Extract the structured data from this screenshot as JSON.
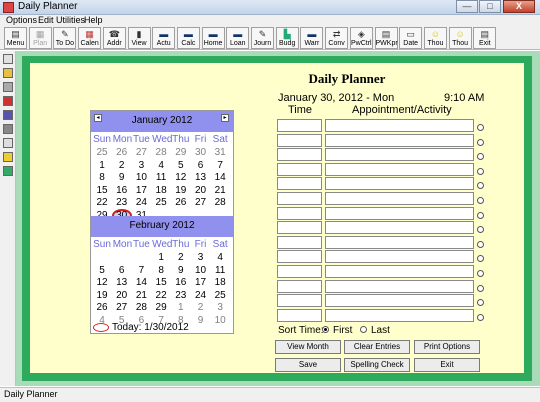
{
  "window": {
    "title": "Daily Planner",
    "min": "—",
    "max": "□",
    "close": "X"
  },
  "menu": [
    "Options",
    "Edit",
    "Utilities",
    "Help"
  ],
  "toolbar": [
    {
      "label": "Menu",
      "icon": "menu-icon",
      "glyph": "▤",
      "color": "#333"
    },
    {
      "label": "Plan",
      "icon": "plan-icon",
      "glyph": "▦",
      "color": "#a0a0a0",
      "disabled": true
    },
    {
      "label": "To Do",
      "icon": "todo-icon",
      "glyph": "✎",
      "color": "#333"
    },
    {
      "label": "Calen",
      "icon": "calendar-icon",
      "glyph": "▦",
      "color": "#b33"
    },
    {
      "label": "Addr",
      "icon": "address-icon",
      "glyph": "☎",
      "color": "#333"
    },
    {
      "label": "View",
      "icon": "view-icon",
      "glyph": "▮",
      "color": "#333"
    },
    {
      "label": "Actu",
      "icon": "actual-icon",
      "glyph": "▬",
      "color": "#136"
    },
    {
      "label": "Calc",
      "icon": "calculator-icon",
      "glyph": "▬",
      "color": "#136"
    },
    {
      "label": "Home",
      "icon": "home-icon",
      "glyph": "▬",
      "color": "#136"
    },
    {
      "label": "Loan",
      "icon": "loan-icon",
      "glyph": "▬",
      "color": "#136"
    },
    {
      "label": "Journ",
      "icon": "journal-icon",
      "glyph": "✎",
      "color": "#333"
    },
    {
      "label": "Budg",
      "icon": "budget-icon",
      "glyph": "▙",
      "color": "#2a7"
    },
    {
      "label": "Warr",
      "icon": "warranty-icon",
      "glyph": "▬",
      "color": "#136"
    },
    {
      "label": "Conv",
      "icon": "convert-icon",
      "glyph": "⇄",
      "color": "#333"
    },
    {
      "label": "PwCtrl",
      "icon": "password-icon",
      "glyph": "◈",
      "color": "#333"
    },
    {
      "label": "PWKpr",
      "icon": "password-keeper-icon",
      "glyph": "▤",
      "color": "#333"
    },
    {
      "label": "Date",
      "icon": "date-icon",
      "glyph": "▭",
      "color": "#333"
    },
    {
      "label": "Thou",
      "icon": "thought-icon",
      "glyph": "☺",
      "color": "#cc0"
    },
    {
      "label": "Thou",
      "icon": "thought-2-icon",
      "glyph": "☺",
      "color": "#cc0"
    },
    {
      "label": "Exit",
      "icon": "exit-icon",
      "glyph": "▤",
      "color": "#333"
    }
  ],
  "planner": {
    "title": "Daily Planner",
    "date": "January 30, 2012 - Mon",
    "time": "9:10 AM",
    "col_time": "Time",
    "col_appt": "Appointment/Activity",
    "slot_count": 14
  },
  "sort": {
    "label": "Sort Time:",
    "first": "First",
    "last": "Last",
    "selected": "first"
  },
  "buttons": {
    "view_month": "View Month",
    "clear_entries": "Clear Entries",
    "print_options": "Print Options",
    "save": "Save",
    "spelling_check": "Spelling Check",
    "exit": "Exit"
  },
  "calendar": {
    "dow": [
      "Sun",
      "Mon",
      "Tue",
      "Wed",
      "Thu",
      "Fri",
      "Sat"
    ],
    "months": [
      {
        "name": "January 2012",
        "weeks": [
          [
            "25",
            "26",
            "27",
            "28",
            "29",
            "30",
            "31"
          ],
          [
            "1",
            "2",
            "3",
            "4",
            "5",
            "6",
            "7"
          ],
          [
            "8",
            "9",
            "10",
            "11",
            "12",
            "13",
            "14"
          ],
          [
            "15",
            "16",
            "17",
            "18",
            "19",
            "20",
            "21"
          ],
          [
            "22",
            "23",
            "24",
            "25",
            "26",
            "27",
            "28"
          ],
          [
            "29",
            "30",
            "31",
            "",
            "",
            "",
            ""
          ]
        ],
        "other_first_row": true
      },
      {
        "name": "February 2012",
        "weeks": [
          [
            "",
            "",
            "",
            "1",
            "2",
            "3",
            "4"
          ],
          [
            "5",
            "6",
            "7",
            "8",
            "9",
            "10",
            "11"
          ],
          [
            "12",
            "13",
            "14",
            "15",
            "16",
            "17",
            "18"
          ],
          [
            "19",
            "20",
            "21",
            "22",
            "23",
            "24",
            "25"
          ],
          [
            "26",
            "27",
            "28",
            "29",
            "1",
            "2",
            "3"
          ],
          [
            "4",
            "5",
            "6",
            "7",
            "8",
            "9",
            "10"
          ]
        ]
      }
    ],
    "today_label": "Today: 1/30/2012"
  },
  "status": "Daily Planner",
  "colors": {
    "frame": "#2eaa5c",
    "background": "#ffffcc",
    "calendar_header": "#9090ee",
    "today_marker": "#d02020"
  }
}
